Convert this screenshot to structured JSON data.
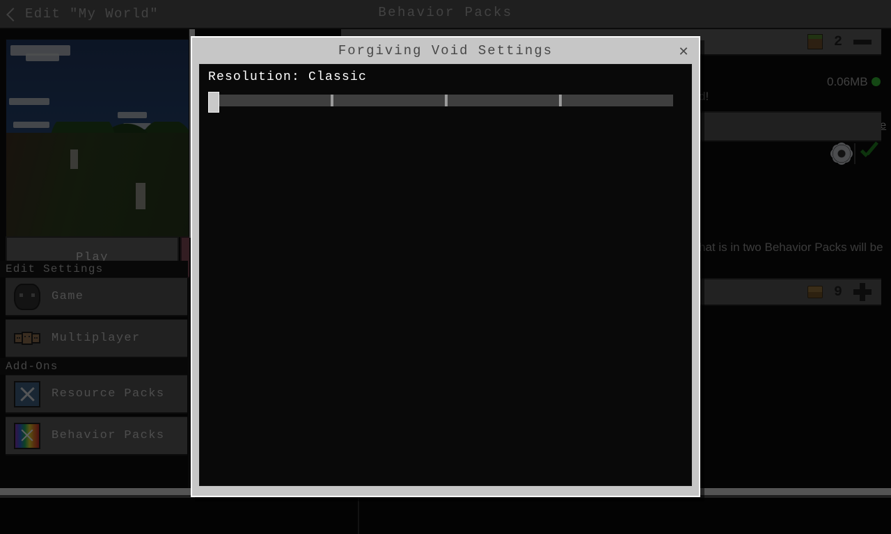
{
  "header": {
    "back_label": "Edit \"My World\"",
    "title": "Behavior Packs",
    "back_icon": "chevron-left-icon"
  },
  "sidebar": {
    "play_button": "Play",
    "sections": [
      {
        "title": "Edit Settings",
        "items": [
          {
            "label": "Game",
            "icon": "controller-icon"
          },
          {
            "label": "Multiplayer",
            "icon": "player-heads-icon"
          }
        ]
      },
      {
        "title": "Add-Ons",
        "items": [
          {
            "label": "Resource Packs",
            "icon": "crossed-swords-icon"
          },
          {
            "label": "Behavior Packs",
            "icon": "rainbow-pack-icon"
          }
        ]
      }
    ]
  },
  "right_panel": {
    "active_pack": {
      "icon": "grass-block-icon",
      "count": "2",
      "collapse_icon": "minus-icon",
      "size": "0.06MB",
      "status_color": "#2fa82f",
      "description_fragment": "d!",
      "read_more": "Read More"
    },
    "search": {
      "value": "",
      "settings_icon": "gear-icon",
      "confirm_icon": "check-icon"
    },
    "available_section": {
      "description_fragment": "hat is in two Behavior Packs will be",
      "icon": "book-icon",
      "count": "9",
      "add_icon": "plus-icon"
    }
  },
  "dialog": {
    "title": "Forgiving Void Settings",
    "close_icon": "close-icon",
    "settings": [
      {
        "label": "Resolution: Classic",
        "control": "slider",
        "value": 0,
        "min": 0,
        "max": 100,
        "ticks": [
          25,
          50,
          75
        ]
      }
    ]
  }
}
